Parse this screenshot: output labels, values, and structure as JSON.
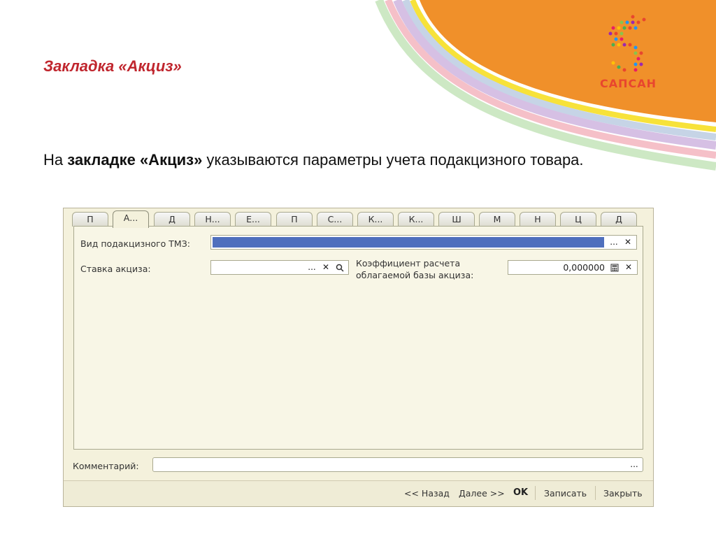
{
  "slide": {
    "title": "Закладка «Акциз»",
    "intro_prefix": "На ",
    "intro_bold": "закладке «Акциз»",
    "intro_suffix": " указываются параметры учета подакцизного товара."
  },
  "logo": {
    "text": "САПСАН",
    "color": "#e8462e"
  },
  "colors": {
    "title": "#c0262e",
    "accent_orange": "#f0902a",
    "selection": "#4f6fbd"
  },
  "tabs": [
    {
      "label": "П"
    },
    {
      "label": "А..."
    },
    {
      "label": "Д"
    },
    {
      "label": "Н..."
    },
    {
      "label": "Е..."
    },
    {
      "label": "П"
    },
    {
      "label": "С..."
    },
    {
      "label": "К..."
    },
    {
      "label": "К..."
    },
    {
      "label": "Ш"
    },
    {
      "label": "М"
    },
    {
      "label": "Н"
    },
    {
      "label": "Ц"
    },
    {
      "label": "Д"
    }
  ],
  "form": {
    "vid_label": "Вид подакцизного ТМЗ:",
    "stavka_label": "Ставка акциза:",
    "koef_label_1": "Коэффициент расчета",
    "koef_label_2": "облагаемой базы акциза:",
    "koef_value": "0,000000",
    "comment_label": "Комментарий:",
    "comment_value": ""
  },
  "buttons": {
    "ellipsis": "...",
    "clear": "✕",
    "back": "<< Назад",
    "next": "Далее >>",
    "ok": "OK",
    "save": "Записать",
    "close": "Закрыть"
  }
}
